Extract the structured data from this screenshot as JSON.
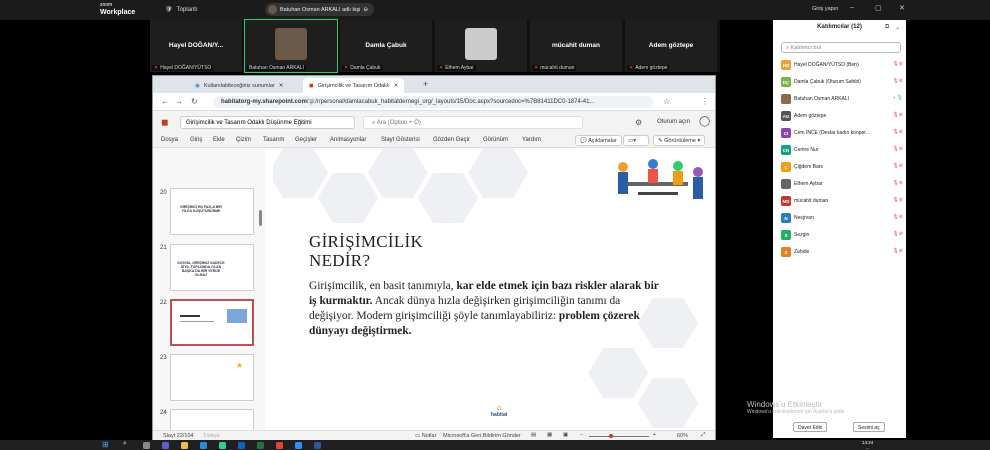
{
  "zoom": {
    "brand_line1": "zoom",
    "brand_line2": "Workplace",
    "meeting": "Toplantı",
    "speaker": "Batuhan Osman ARKALI adlı kişi",
    "login": "Giriş yapın"
  },
  "video_tiles": [
    {
      "name": "Hayel DOĞAN/Y...",
      "label": "Hayel DOĞAN/YÜTSO"
    },
    {
      "name": "",
      "label": "Batuhan Osman ARKALI"
    },
    {
      "name": "Damla Çabuk",
      "label": "Damla Çabuk"
    },
    {
      "name": "",
      "label": "Ethem Aybar"
    },
    {
      "name": "mücahit duman",
      "label": "mücahit duman"
    },
    {
      "name": "Adem göztepe",
      "label": "Adem göztepe"
    }
  ],
  "browser": {
    "tab1": "Kullanılabileceğiniz sunumlar",
    "tab2": "Girişimcilik ve Tasarım Odaklı",
    "url_domain": "habitatorg-my.sharepoint.com",
    "url_path": "/:p:/r/personal/damlacabuk_habitatdernegi_org/_layouts/15/Doc.aspx?sourcedoc=%7B81411DC0-1874-41..."
  },
  "ppt": {
    "doc_title": "Girişimcilik ve Tasarım Odaklı Düşünme Eğitimi",
    "search_placeholder": "Ara (Option + Ö)",
    "open_label": "Oturum açın",
    "ribbon_tabs": [
      "Dosya",
      "Giriş",
      "Ekle",
      "Çizim",
      "Tasarım",
      "Geçişler",
      "Animasyonlar",
      "Slayt Gösterisi",
      "Gözden Geçir",
      "Görünüm",
      "Yardım"
    ],
    "comments": "Açıklamalar",
    "view_label": "Görüntüleme",
    "thumbs": [
      {
        "num": "20",
        "text": "GİRİŞİMCİ EN FAZLA BİR YILDA KÜŞÜTÜRÜNME"
      },
      {
        "num": "21",
        "text": "SOSYAL GİRİŞİMCİ SADECE SİYİL TOPLUMDA OLAN BAŞKA DA BİR YERDE OLMAZ"
      },
      {
        "num": "22",
        "text": ""
      },
      {
        "num": "23",
        "text": ""
      },
      {
        "num": "24",
        "text": ""
      }
    ],
    "slide_title_1": "GİRİŞİMCİLİK",
    "slide_title_2": "NEDİR?",
    "slide_body_1": "Girişimcilik, en basit tanımıyla, ",
    "slide_body_bold1": "kar elde etmek için bazı riskler alarak bir iş kurmaktır.",
    "slide_body_2": " Ancak dünya hızla değişirken girişimciliğin tanımı da değişiyor. Modern girişimciliği şöyle tanımlayabiliriz: ",
    "slide_body_bold2": "problem çözerek dünyayı değiştirmek.",
    "logo": "habitat",
    "status_slide": "Slayt 22/104",
    "status_lang": "Türkçe",
    "notes": "Notlar",
    "feedback": "Microsoft'a Geri Bildirim Gönder",
    "zoom_pct": "60%"
  },
  "panel": {
    "title": "Katılımcılar (12)",
    "search": "Katılımcı bul",
    "participants": [
      {
        "initials": "HD",
        "color": "#f0a030",
        "name": "Hayel DOĞAN/YÜTSO (Ben)"
      },
      {
        "initials": "DÇ",
        "color": "#7cb342",
        "name": "Damla Çabuk (Oturum Sahibi)"
      },
      {
        "initials": "",
        "color": "#8a6a4a",
        "name": "Batuhan Osman ARKALI"
      },
      {
        "initials": "AG",
        "color": "#555",
        "name": "Adem göztepe"
      },
      {
        "initials": "CI",
        "color": "#8e44ad",
        "name": "Cem İNCE (Destar kadın kooper..."
      },
      {
        "initials": "CN",
        "color": "#16a085",
        "name": "Cemre Nur"
      },
      {
        "initials": "Ç",
        "color": "#f39c12",
        "name": "Çiğdem Bars"
      },
      {
        "initials": "",
        "color": "#666",
        "name": "Ethem Aybar"
      },
      {
        "initials": "MD",
        "color": "#c0392b",
        "name": "mücahit duman"
      },
      {
        "initials": "N",
        "color": "#2980b9",
        "name": "Nesjrvan"
      },
      {
        "initials": "S",
        "color": "#27ae60",
        "name": "Sezgin"
      },
      {
        "initials": "Z",
        "color": "#e67e22",
        "name": "Zahide"
      }
    ],
    "invite": "Davet Edin",
    "unmute": "Sesimi aç"
  },
  "watermark": {
    "line1": "Windows'u Etkinleştir",
    "line2": "Windows'u etkinleştirmek için Ayarlar'a gidin."
  },
  "clock": {
    "time": "14:24",
    "date": "..."
  }
}
